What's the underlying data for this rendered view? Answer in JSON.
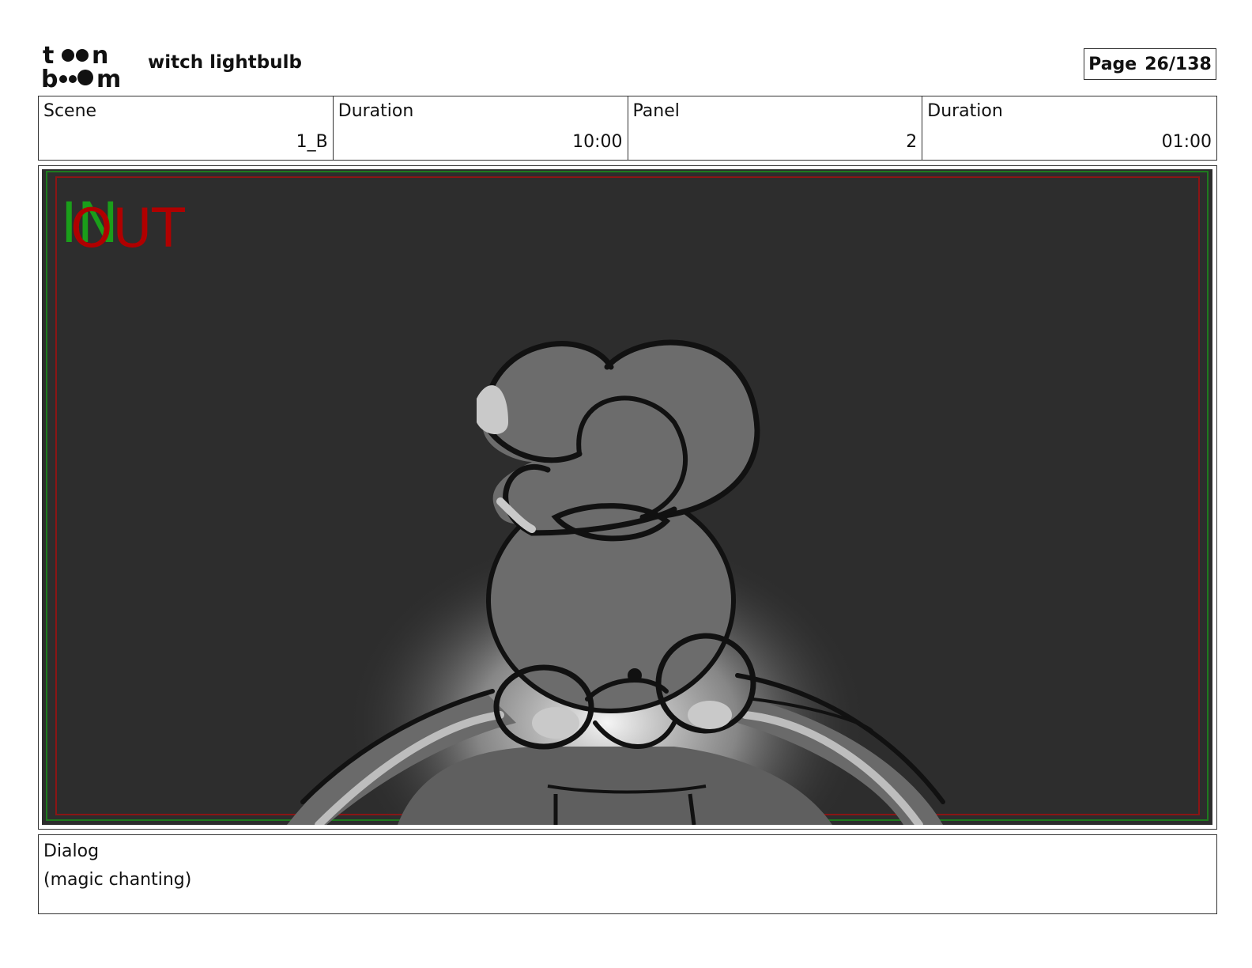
{
  "header": {
    "logo_text_top": "toon",
    "logo_text_bottom": "boom",
    "project_title": "witch lightbulb",
    "page_label": "Page",
    "page_number": "26/138"
  },
  "info": {
    "scene_label": "Scene",
    "scene_value": "1_B",
    "duration1_label": "Duration",
    "duration1_value": "10:00",
    "panel_label": "Panel",
    "panel_value": "2",
    "duration2_label": "Duration",
    "duration2_value": "01:00"
  },
  "panel": {
    "in_marker": "IN",
    "out_marker": "OUT",
    "in_color": "#1a9e1a",
    "out_color": "#b00000",
    "background_color": "#2d2d2d"
  },
  "dialog": {
    "label": "Dialog",
    "text": "(magic chanting)"
  }
}
